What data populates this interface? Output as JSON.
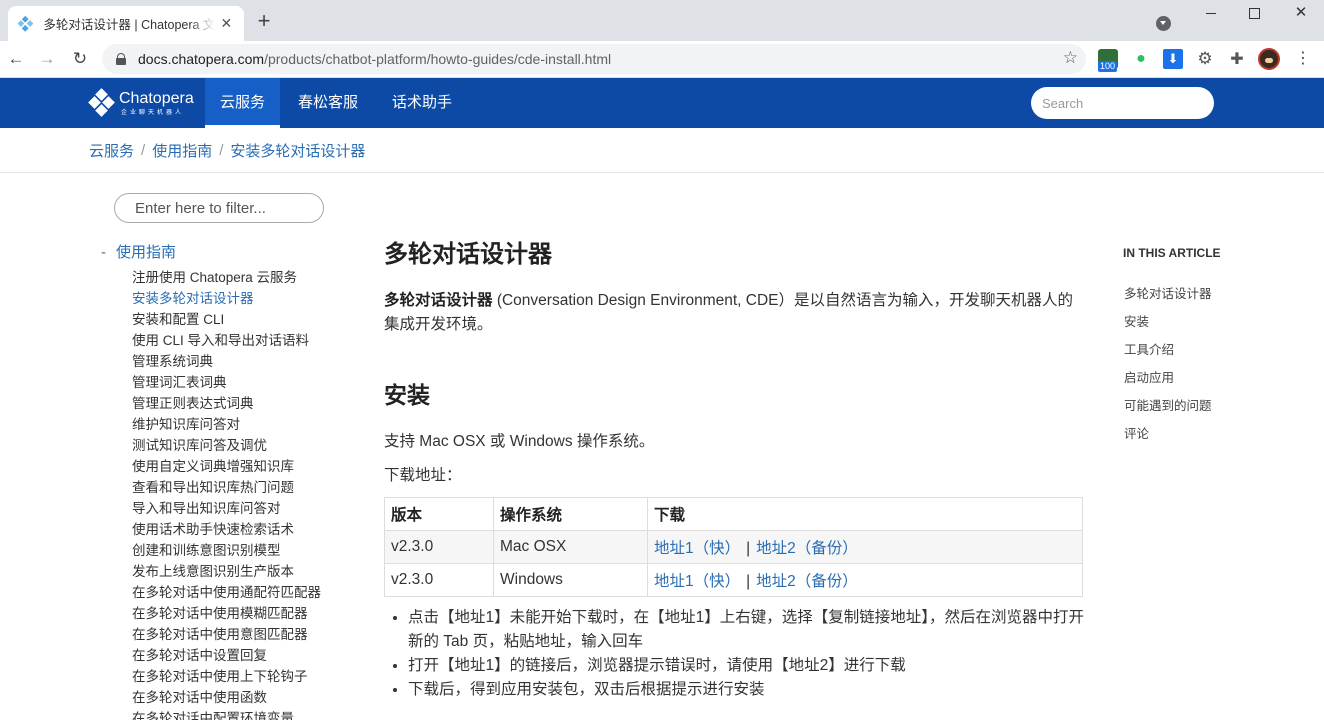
{
  "browser": {
    "tab_title": "多轮对话设计器 | Chatopera 文档中心",
    "url_host": "docs.chatopera.com",
    "url_path": "/products/chatbot-platform/howto-guides/cde-install.html",
    "ext_badge": "100"
  },
  "site": {
    "logo_name": "Chatopera",
    "logo_sub": "企业聊天机器人",
    "nav": [
      "云服务",
      "春松客服",
      "话术助手"
    ],
    "search_placeholder": "Search"
  },
  "breadcrumb": [
    "云服务",
    "使用指南",
    "安装多轮对话设计器"
  ],
  "sidebar": {
    "filter_placeholder": "Enter here to filter...",
    "group_dash": "-",
    "group_title": "使用指南",
    "items": [
      "注册使用 Chatopera 云服务",
      "安装多轮对话设计器",
      "安装和配置 CLI",
      "使用 CLI 导入和导出对话语料",
      "管理系统词典",
      "管理词汇表词典",
      "管理正则表达式词典",
      "维护知识库问答对",
      "测试知识库问答及调优",
      "使用自定义词典增强知识库",
      "查看和导出知识库热门问题",
      "导入和导出知识库问答对",
      "使用话术助手快速检索话术",
      "创建和训练意图识别模型",
      "发布上线意图识别生产版本",
      "在多轮对话中使用通配符匹配器",
      "在多轮对话中使用模糊匹配器",
      "在多轮对话中使用意图匹配器",
      "在多轮对话中设置回复",
      "在多轮对话中使用上下轮钩子",
      "在多轮对话中使用函数",
      "在多轮对话中配置环境变量"
    ]
  },
  "article": {
    "title": "多轮对话设计器",
    "intro_bold": "多轮对话设计器",
    "intro_rest": " (Conversation Design Environment, CDE）是以自然语言为输入，开发聊天机器人的集成开发环境。",
    "install_heading": "安装",
    "os_support": "支持 Mac OSX 或 Windows 操作系统。",
    "download_label": "下载地址：",
    "table": {
      "headers": [
        "版本",
        "操作系统",
        "下载"
      ],
      "rows": [
        {
          "version": "v2.3.0",
          "os": "Mac OSX",
          "link1": "地址1（快）",
          "sep": "|",
          "link2": "地址2（备份）"
        },
        {
          "version": "v2.3.0",
          "os": "Windows",
          "link1": "地址1（快）",
          "sep": "|",
          "link2": "地址2（备份）"
        }
      ]
    },
    "bullets": [
      "点击【地址1】未能开始下载时，在【地址1】上右键，选择【复制链接地址】，然后在浏览器中打开新的 Tab 页，粘贴地址，输入回车",
      "打开【地址1】的链接后，浏览器提示错误时，请使用【地址2】进行下载",
      "下载后，得到应用安装包，双击后根据提示进行安装"
    ]
  },
  "toc": {
    "title": "IN THIS ARTICLE",
    "items": [
      "多轮对话设计器",
      "安装",
      "工具介绍",
      "启动应用",
      "可能遇到的问题",
      "评论"
    ]
  },
  "colors": {
    "header": "#0c4aa6",
    "link": "#2a6db3"
  }
}
